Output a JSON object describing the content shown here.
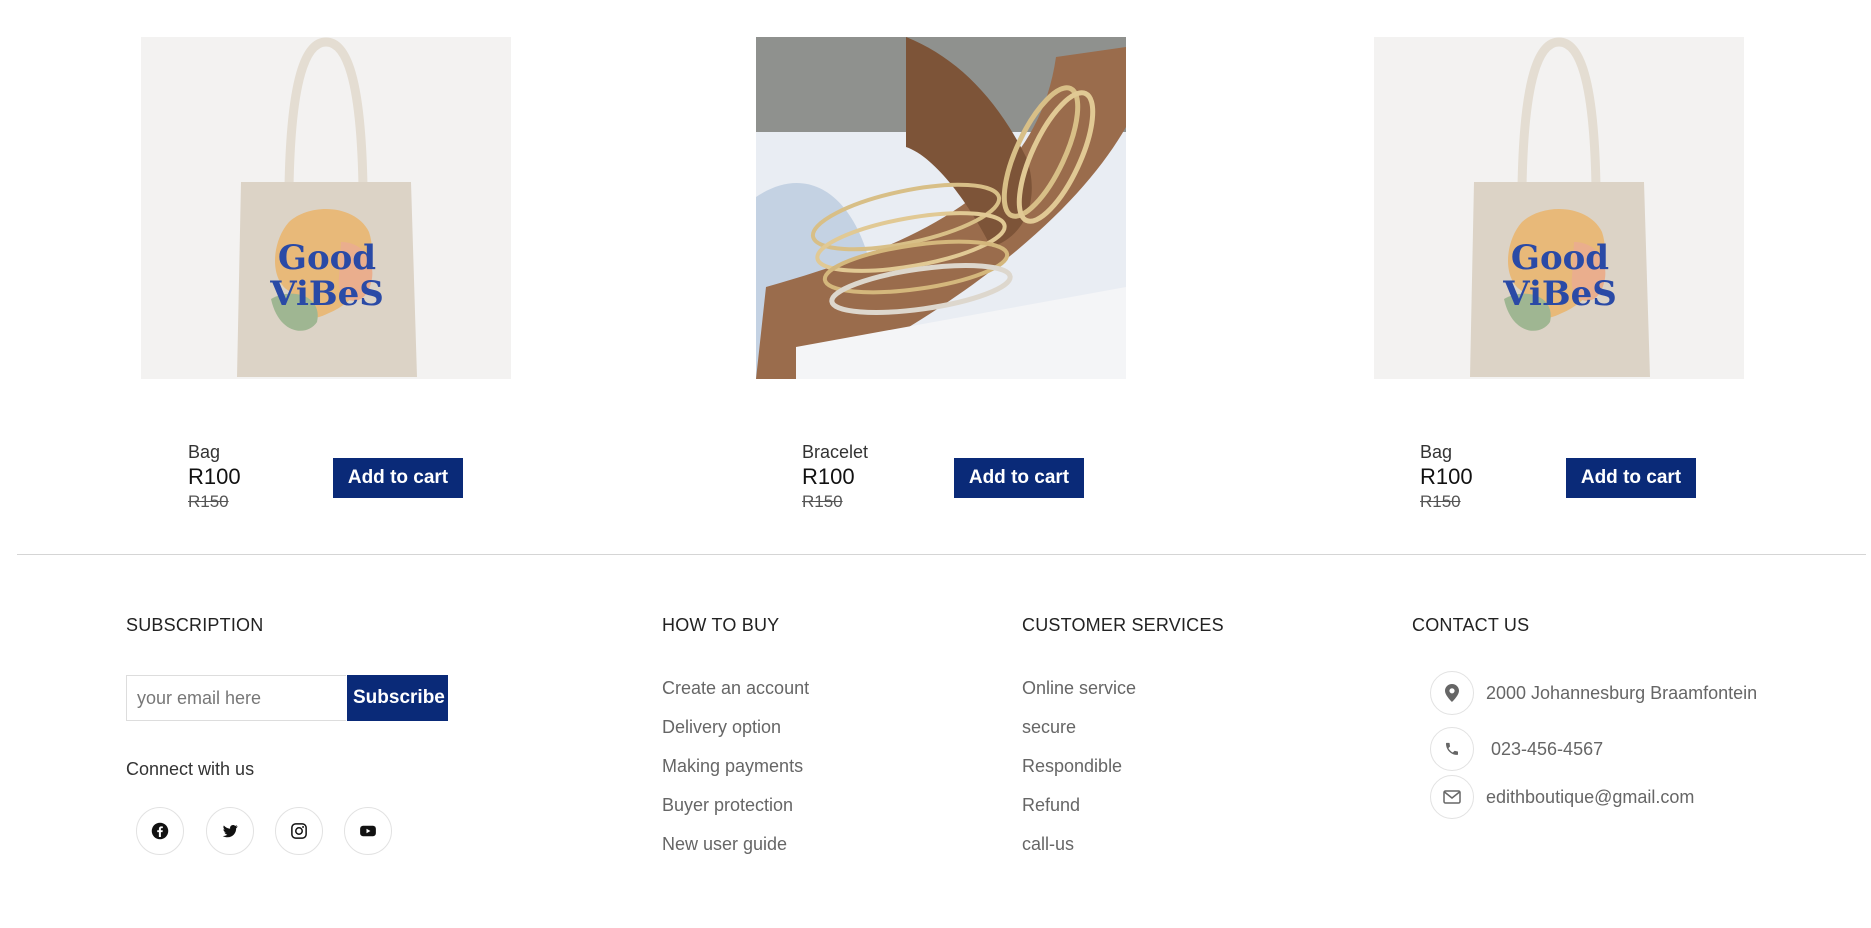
{
  "products": [
    {
      "name": "Bag",
      "price": "R100",
      "old_price": "R150",
      "button": "Add to cart",
      "image": "good-vibes-tote-bag-image"
    },
    {
      "name": "Bracelet",
      "price": "R100",
      "old_price": "R150",
      "button": "Add to cart",
      "image": "gold-bracelets-on-wrist-image"
    },
    {
      "name": "Bag",
      "price": "R100",
      "old_price": "R150",
      "button": "Add to cart",
      "image": "good-vibes-tote-bag-image"
    }
  ],
  "bag_print": {
    "line1": "Good",
    "line2": "ViBeS"
  },
  "footer": {
    "subscription": {
      "title": "SUBSCRIPTION",
      "placeholder": "your email here",
      "button": "Subscribe",
      "connect": "Connect with us",
      "socials": [
        "facebook-icon",
        "twitter-icon",
        "instagram-icon",
        "youtube-icon"
      ]
    },
    "how_to_buy": {
      "title": "HOW TO BUY",
      "links": [
        "Create an account",
        "Delivery option",
        "Making payments",
        "Buyer protection",
        "New user guide"
      ]
    },
    "customer_services": {
      "title": "CUSTOMER SERVICES",
      "links": [
        "Online service",
        "secure",
        "Respondible",
        "Refund",
        "call-us"
      ]
    },
    "contact": {
      "title": "CONTACT US",
      "address": "2000 Johannesburg Braamfontein",
      "phone": "023-456-4567",
      "email": "edithboutique@gmail.com"
    }
  },
  "colors": {
    "accent": "#0a2a78",
    "text_muted": "#666666",
    "divider": "#d5d5d5"
  }
}
